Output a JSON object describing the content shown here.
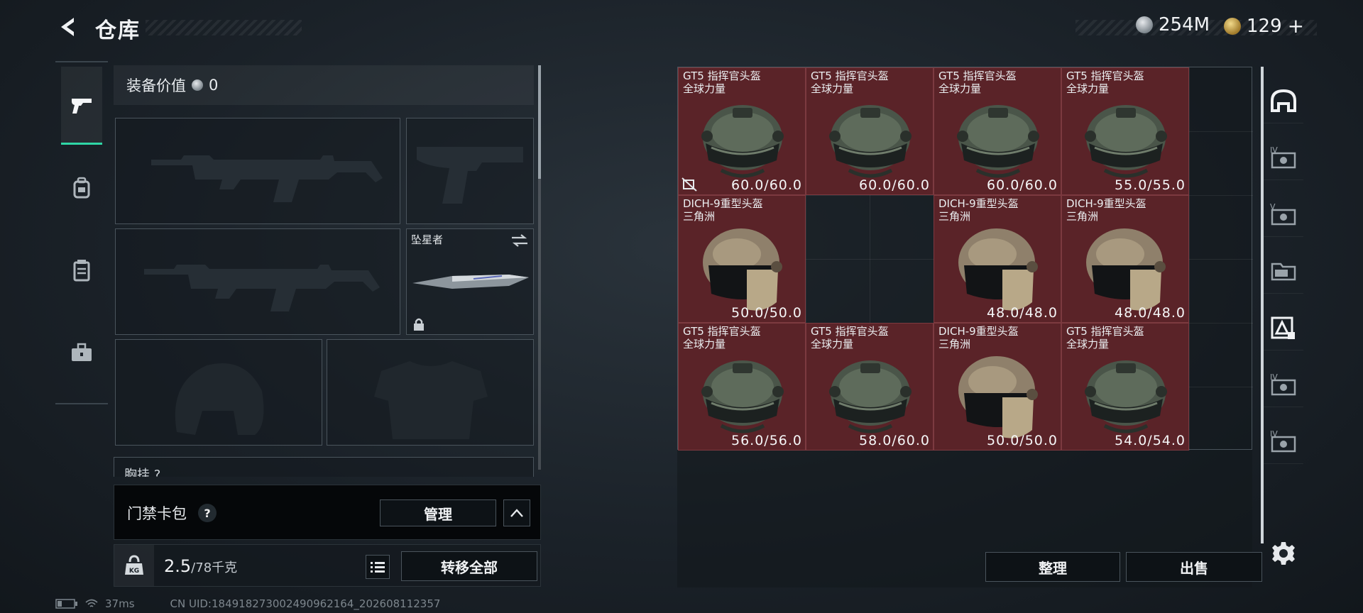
{
  "header": {
    "title": "仓库",
    "currencies": [
      {
        "icon": "silver-coin-icon",
        "value": "254M"
      },
      {
        "icon": "gold-coin-icon",
        "value": "129"
      },
      {
        "add_label": "+"
      }
    ]
  },
  "loadout": {
    "value_label": "装备价值",
    "value": "0",
    "melee_name": "坠星者",
    "chest_label": "胸挂 ?"
  },
  "access_card": {
    "label": "门禁卡包",
    "help": "?",
    "manage_label": "管理"
  },
  "weight": {
    "unit_icon": "KG",
    "current": "2.5",
    "max": "/78千克",
    "transfer_label": "转移全部"
  },
  "status_bar": {
    "ping": "37ms",
    "uid": "CN UID:18491827300249096216​4_202608112357"
  },
  "storage": {
    "items": [
      {
        "name": "GT5 指挥官头盔",
        "sub": "全球力量",
        "durability": "60.0/60.0",
        "type": "gt5",
        "flag": true
      },
      {
        "name": "GT5 指挥官头盔",
        "sub": "全球力量",
        "durability": "60.0/60.0",
        "type": "gt5"
      },
      {
        "name": "GT5 指挥官头盔",
        "sub": "全球力量",
        "durability": "60.0/60.0",
        "type": "gt5"
      },
      {
        "name": "GT5 指挥官头盔",
        "sub": "全球力量",
        "durability": "55.0/55.0",
        "type": "gt5"
      },
      {
        "name": "DICH-9重型头盔",
        "sub": "三角洲",
        "durability": "50.0/50.0",
        "type": "dich"
      },
      {
        "name": "DICH-9重型头盔",
        "sub": "三角洲",
        "durability": "48.0/48.0",
        "type": "dich"
      },
      {
        "name": "DICH-9重型头盔",
        "sub": "三角洲",
        "durability": "48.0/48.0",
        "type": "dich"
      },
      {
        "name": "GT5 指挥官头盔",
        "sub": "全球力量",
        "durability": "56.0/56.0",
        "type": "gt5"
      },
      {
        "name": "GT5 指挥官头盔",
        "sub": "全球力量",
        "durability": "58.0/60.0",
        "type": "gt5"
      },
      {
        "name": "DICH-9重型头盔",
        "sub": "三角洲",
        "durability": "50.0/50.0",
        "type": "dich"
      },
      {
        "name": "GT5 指挥官头盔",
        "sub": "全球力量",
        "durability": "54.0/54.0",
        "type": "gt5"
      }
    ],
    "sort_label": "整理",
    "sell_label": "出售"
  },
  "right_rail": {
    "tabs": [
      "helmet-category-icon",
      "tier-iv-card-icon",
      "tier-v-card-icon",
      "folder-icon",
      "mixed-category-icon",
      "tier-iv-card-icon",
      "tier-iv-card-icon"
    ],
    "tier_labels": [
      "IV",
      "V",
      "IV",
      "IV"
    ]
  },
  "colors": {
    "accent": "#2fd6a6",
    "item_bg": "#5a2328",
    "panel_border": "#4a545c"
  }
}
